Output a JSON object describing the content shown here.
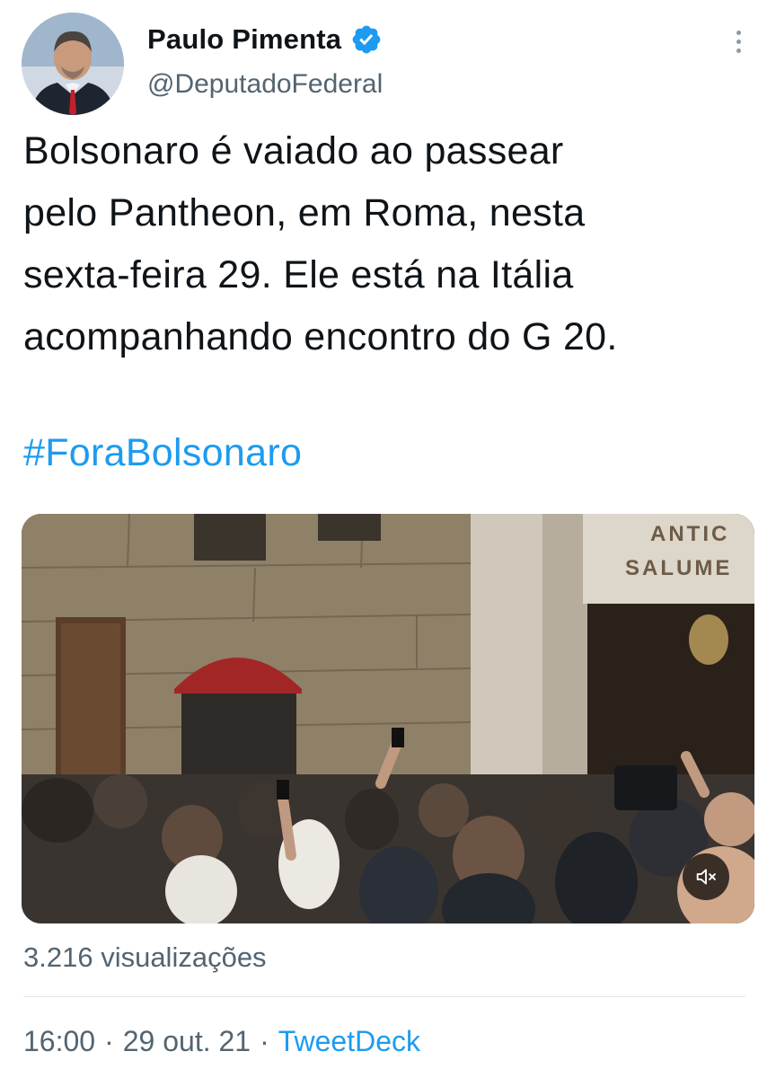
{
  "author": {
    "display_name": "Paulo Pimenta",
    "handle": "@DeputadoFederal",
    "verified_icon": "verified-badge-icon",
    "verified_color": "#1d9bf0"
  },
  "tweet": {
    "text_lines": [
      "Bolsonaro é vaiado ao passear",
      "pelo Pantheon, em Roma, nesta",
      "sexta-feira 29. Ele está na Itália",
      "acompanhando encontro do G 20."
    ],
    "hashtag": "#ForaBolsonaro"
  },
  "media": {
    "type": "video",
    "shop_sign_line1": "ANTIC",
    "shop_sign_line2": "SALUME",
    "mute_icon": "speaker-muted-icon"
  },
  "stats": {
    "views": "3.216 visualizações"
  },
  "meta": {
    "time": "16:00",
    "separator": "·",
    "date": "29 out. 21",
    "source": "TweetDeck"
  },
  "colors": {
    "text_primary": "#0f1419",
    "text_secondary": "#536471",
    "accent": "#1d9bf0"
  }
}
